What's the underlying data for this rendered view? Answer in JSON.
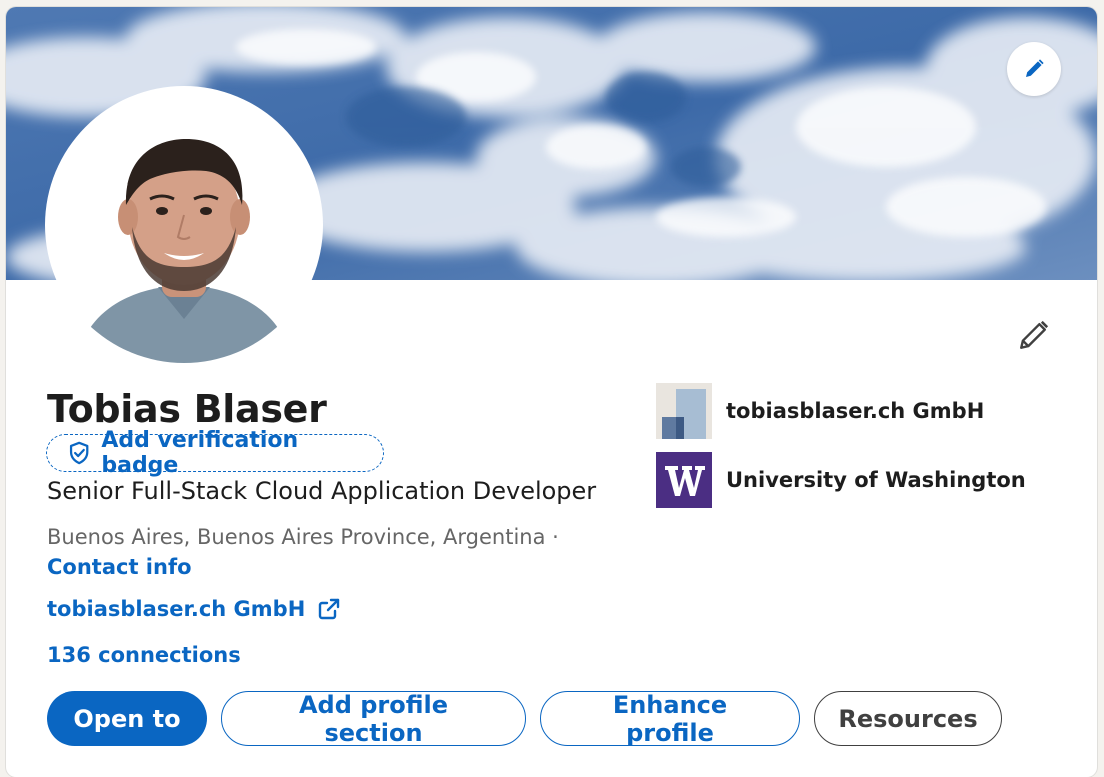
{
  "profile": {
    "name": "Tobias Blaser",
    "verification_label": "Add verification badge",
    "headline": "Senior Full-Stack Cloud Application Developer",
    "location": "Buenos Aires, Buenos Aires Province, Argentina ·",
    "contact_label": "Contact info",
    "website_label": "tobiasblaser.ch GmbH",
    "connections_label": "136 connections"
  },
  "organizations": [
    {
      "name": "tobiasblaser.ch GmbH",
      "icon": "company-logo"
    },
    {
      "name": "University of Washington",
      "icon": "uw-logo"
    }
  ],
  "actions": {
    "open_to": "Open to",
    "add_section": "Add profile section",
    "enhance": "Enhance profile",
    "resources": "Resources"
  },
  "icons": {
    "banner_edit": "pencil-icon",
    "intro_edit": "pencil-icon",
    "verify": "shield-check-icon",
    "external": "external-link-icon"
  },
  "colors": {
    "accent": "#0a66c2",
    "text": "#1d1d1d",
    "muted": "#666666",
    "uw_purple": "#4b2e83"
  }
}
